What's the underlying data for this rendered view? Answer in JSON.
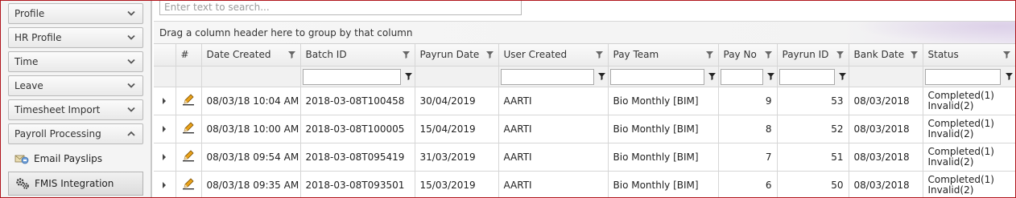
{
  "sidebar": {
    "items": [
      {
        "label": "Profile",
        "expanded": false
      },
      {
        "label": "HR Profile",
        "expanded": false
      },
      {
        "label": "Time",
        "expanded": false
      },
      {
        "label": "Leave",
        "expanded": false
      },
      {
        "label": "Timesheet Import",
        "expanded": false
      },
      {
        "label": "Payroll Processing",
        "expanded": true
      }
    ],
    "subitems": [
      {
        "label": "Email Payslips",
        "icon": "email-payslips-icon",
        "selected": false
      },
      {
        "label": "FMIS Integration",
        "icon": "gears-icon",
        "selected": true
      }
    ]
  },
  "search": {
    "placeholder": "Enter text to search...",
    "value": ""
  },
  "group_panel": {
    "text": "Drag a column header here to group by that column"
  },
  "grid": {
    "columns": [
      {
        "key": "expand",
        "label": ""
      },
      {
        "key": "edit",
        "label": "#"
      },
      {
        "key": "date_created",
        "label": "Date Created"
      },
      {
        "key": "batch_id",
        "label": "Batch ID"
      },
      {
        "key": "payrun_date",
        "label": "Payrun Date"
      },
      {
        "key": "user_created",
        "label": "User Created"
      },
      {
        "key": "pay_team",
        "label": "Pay Team"
      },
      {
        "key": "pay_no",
        "label": "Pay No"
      },
      {
        "key": "payrun_id",
        "label": "Payrun ID"
      },
      {
        "key": "bank_date",
        "label": "Bank Date"
      },
      {
        "key": "status",
        "label": "Status"
      }
    ],
    "rows": [
      {
        "date_created": "08/03/18 10:04 AM",
        "batch_id": "2018-03-08T100458",
        "payrun_date": "30/04/2019",
        "user_created": "AARTI",
        "pay_team": "Bio Monthly [BIM]",
        "pay_no": "9",
        "payrun_id": "53",
        "bank_date": "08/03/2018",
        "status_line1": "Completed(1)",
        "status_line2": "Invalid(2)"
      },
      {
        "date_created": "08/03/18 10:00 AM",
        "batch_id": "2018-03-08T100005",
        "payrun_date": "15/04/2019",
        "user_created": "AARTI",
        "pay_team": "Bio Monthly [BIM]",
        "pay_no": "8",
        "payrun_id": "52",
        "bank_date": "08/03/2018",
        "status_line1": "Completed(1)",
        "status_line2": "Invalid(2)"
      },
      {
        "date_created": "08/03/18 09:54 AM",
        "batch_id": "2018-03-08T095419",
        "payrun_date": "31/03/2019",
        "user_created": "AARTI",
        "pay_team": "Bio Monthly [BIM]",
        "pay_no": "7",
        "payrun_id": "51",
        "bank_date": "08/03/2018",
        "status_line1": "Completed(1)",
        "status_line2": "Invalid(2)"
      },
      {
        "date_created": "08/03/18 09:35 AM",
        "batch_id": "2018-03-08T093501",
        "payrun_date": "15/03/2019",
        "user_created": "AARTI",
        "pay_team": "Bio Monthly [BIM]",
        "pay_no": "6",
        "payrun_id": "50",
        "bank_date": "08/03/2018",
        "status_line1": "Completed(1)",
        "status_line2": "Invalid(2)"
      }
    ]
  },
  "colors": {
    "frame_border": "#b0161d",
    "edit_icon": "#d08a00"
  }
}
